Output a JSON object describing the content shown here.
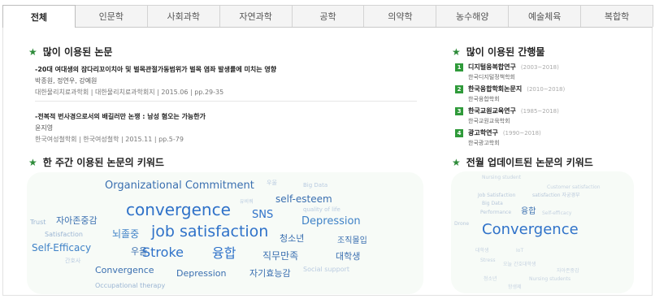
{
  "tabs": [
    "전체",
    "인문학",
    "사회과학",
    "자연과학",
    "공학",
    "의약학",
    "농수해양",
    "예술체육",
    "복합학"
  ],
  "sections": {
    "popular_papers": "많이 이용된 논문",
    "popular_journals": "많이 이용된 간행물",
    "weekly_keywords": "한 주간 이용된 논문의 키워드",
    "monthly_keywords": "전월 업데이트된 논문의 키워드"
  },
  "papers": [
    {
      "title": "-20대 여대생의 잠다리꼬이치아 및 벌목관절가동범위가 벌목 염좌 발생률에 미치는 영향",
      "authors": "박종원, 정연우, 강예원",
      "meta": "대한물리치료과학회 | 대한물리치료과학회지 | 2015.06 | pp.29-35"
    },
    {
      "title": "-전복적 번사경으로서의 배길러만 논쟁 : 남성 혐오는 가능한가",
      "authors": "윤지영",
      "meta": "한국여성철학회 | 한국여성철학 | 2015.11 | pp.5-79"
    }
  ],
  "journals": [
    {
      "rank": "1",
      "name": "디지털융복합연구",
      "years": "(2003~2018)",
      "publisher": "한국디지털정책학회"
    },
    {
      "rank": "2",
      "name": "한국융합학회논문지",
      "years": "(2010~2018)",
      "publisher": "한국융합학회"
    },
    {
      "rank": "3",
      "name": "한국교원교육연구",
      "years": "(1985~2018)",
      "publisher": "한국교원교육학회"
    },
    {
      "rank": "4",
      "name": "광고학연구",
      "years": "(1990~2018)",
      "publisher": "한국광고학회"
    }
  ],
  "weekly_cloud": [
    {
      "text": "Organizational Commitment",
      "color": "#3a6fb0",
      "size": 13
    },
    {
      "text": "우울",
      "color": "#b9cbe0",
      "size": 7
    },
    {
      "text": "Big Data",
      "color": "#b9cbe0",
      "size": 7
    },
    {
      "text": "convergence",
      "color": "#2f72c9",
      "size": 20
    },
    {
      "text": "유비쿼",
      "color": "#b9cbe0",
      "size": 6
    },
    {
      "text": "self-esteem",
      "color": "#3a6fb0",
      "size": 12
    },
    {
      "text": "quality of life",
      "color": "#b9cbe0",
      "size": 7
    },
    {
      "text": "Trust",
      "color": "#9bb5d3",
      "size": 8
    },
    {
      "text": "자아존중감",
      "color": "#3a6fb0",
      "size": 11
    },
    {
      "text": "SNS",
      "color": "#2f72c9",
      "size": 13
    },
    {
      "text": "Depression",
      "color": "#3f82c7",
      "size": 13
    },
    {
      "text": "Satisfaction",
      "color": "#9bb5d3",
      "size": 8
    },
    {
      "text": "뇌졸중",
      "color": "#3f82c7",
      "size": 12
    },
    {
      "text": "job satisfaction",
      "color": "#2f72c9",
      "size": 19
    },
    {
      "text": "청소년",
      "color": "#3a6fb0",
      "size": 11
    },
    {
      "text": "조직몰입",
      "color": "#3a6fb0",
      "size": 10
    },
    {
      "text": "Self-Efficacy",
      "color": "#3f82c7",
      "size": 12
    },
    {
      "text": "우울",
      "color": "#3a6fb0",
      "size": 11
    },
    {
      "text": "Stroke",
      "color": "#2f72c9",
      "size": 16
    },
    {
      "text": "융합",
      "color": "#2f72c9",
      "size": 16
    },
    {
      "text": "직무만족",
      "color": "#3a6fb0",
      "size": 12
    },
    {
      "text": "대학생",
      "color": "#3a6fb0",
      "size": 11
    },
    {
      "text": "간호사",
      "color": "#b9cbe0",
      "size": 7
    },
    {
      "text": "Convergence",
      "color": "#3a6fb0",
      "size": 11
    },
    {
      "text": "Depression",
      "color": "#3a6fb0",
      "size": 11
    },
    {
      "text": "자기효능감",
      "color": "#3a6fb0",
      "size": 11
    },
    {
      "text": "Social support",
      "color": "#b9cbe0",
      "size": 8
    },
    {
      "text": "Occupational therapy",
      "color": "#9bb5d3",
      "size": 8
    }
  ],
  "monthly_cloud": [
    {
      "text": "Nursing student",
      "color": "#c5d2e0",
      "size": 6
    },
    {
      "text": "Customer satisfaction",
      "color": "#c5d2e0",
      "size": 6
    },
    {
      "text": "Job Satisfaction",
      "color": "#b7c7da",
      "size": 6
    },
    {
      "text": "satisfaction 자궁경부",
      "color": "#b7c7da",
      "size": 6
    },
    {
      "text": "Big Data",
      "color": "#b7c7da",
      "size": 6
    },
    {
      "text": "Performance",
      "color": "#b7c7da",
      "size": 6
    },
    {
      "text": "융합",
      "color": "#3a6fb0",
      "size": 10
    },
    {
      "text": "Self-efficacy",
      "color": "#c5d2e0",
      "size": 6
    },
    {
      "text": "Drone",
      "color": "#b7c7da",
      "size": 6
    },
    {
      "text": "Convergence",
      "color": "#2f72c9",
      "size": 18
    },
    {
      "text": "대학생",
      "color": "#c5d2e0",
      "size": 6
    },
    {
      "text": "IoT",
      "color": "#c5d2e0",
      "size": 6
    },
    {
      "text": "Stress",
      "color": "#c5d2e0",
      "size": 6
    },
    {
      "text": "오늘 간호대학생",
      "color": "#c5d2e0",
      "size": 6
    },
    {
      "text": "자아존중감",
      "color": "#c5d2e0",
      "size": 6
    },
    {
      "text": "청소년",
      "color": "#c5d2e0",
      "size": 6
    },
    {
      "text": "Nursing students",
      "color": "#c5d2e0",
      "size": 6
    },
    {
      "text": "항생제",
      "color": "#c5d2e0",
      "size": 6
    }
  ]
}
